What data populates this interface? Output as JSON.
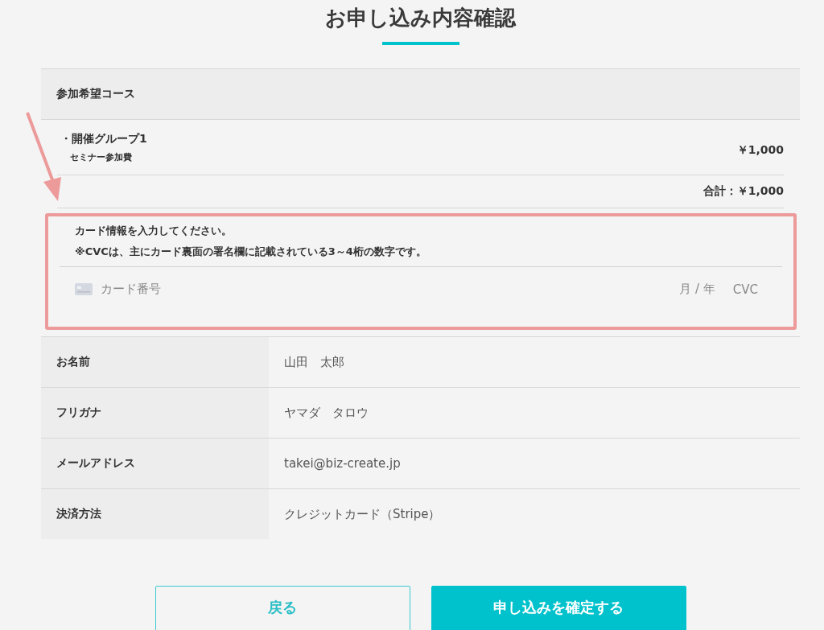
{
  "title": "お申し込み内容確認",
  "course": {
    "heading": "参加希望コース",
    "item": {
      "name": "・開催グループ1",
      "sub": "セミナー参加費",
      "price": "￥1,000"
    },
    "total": "合計：￥1,000"
  },
  "card": {
    "notes": [
      "カード情報を入力してください。",
      "※CVCは、主にカード裏面の署名欄に記載されている3～4桁の数字です。"
    ],
    "number_placeholder": "カード番号",
    "expiry_placeholder": "月 / 年",
    "cvc_placeholder": "CVC"
  },
  "rows": [
    {
      "label": "お名前",
      "value": "山田　太郎"
    },
    {
      "label": "フリガナ",
      "value": "ヤマダ　タロウ"
    },
    {
      "label": "メールアドレス",
      "value": "takei@biz-create.jp"
    },
    {
      "label": "決済方法",
      "value": "クレジットカード（Stripe）"
    }
  ],
  "buttons": [
    {
      "label": "戻る",
      "kind": "secondary"
    },
    {
      "label": "申し込みを確定する",
      "kind": "primary"
    }
  ]
}
